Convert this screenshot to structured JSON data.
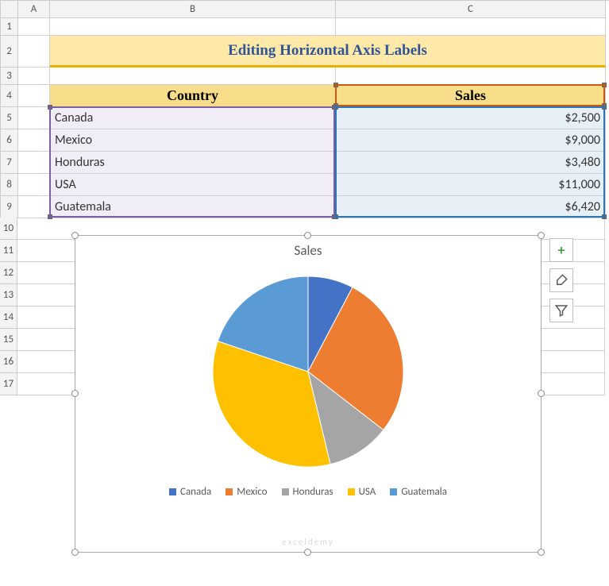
{
  "columns": {
    "A": "A",
    "B": "B",
    "C": "C"
  },
  "rows": [
    "1",
    "2",
    "3",
    "4",
    "5",
    "6",
    "7",
    "8",
    "9",
    "10",
    "11",
    "12",
    "13",
    "14",
    "15",
    "16",
    "17"
  ],
  "title": "Editing Horizontal Axis Labels",
  "table": {
    "headers": {
      "country": "Country",
      "sales": "Sales"
    },
    "rows": [
      {
        "country": "Canada",
        "sales": "$2,500"
      },
      {
        "country": "Mexico",
        "sales": "$9,000"
      },
      {
        "country": "Honduras",
        "sales": "$3,480"
      },
      {
        "country": "USA",
        "sales": "$11,000"
      },
      {
        "country": "Guatemala",
        "sales": "$6,420"
      }
    ]
  },
  "chart": {
    "title": "Sales",
    "legend": [
      "Canada",
      "Mexico",
      "Honduras",
      "USA",
      "Guatemala"
    ]
  },
  "chart_data": {
    "type": "pie",
    "title": "Sales",
    "categories": [
      "Canada",
      "Mexico",
      "Honduras",
      "USA",
      "Guatemala"
    ],
    "values": [
      2500,
      9000,
      3480,
      11000,
      6420
    ],
    "colors": {
      "Canada": "#4472c4",
      "Mexico": "#ed7d31",
      "Honduras": "#a5a5a5",
      "USA": "#ffc000",
      "Guatemala": "#5b9bd5"
    }
  },
  "side_buttons": {
    "plus": "chart-elements-button",
    "brush": "chart-styles-button",
    "filter": "chart-filters-button"
  },
  "watermark": "exceldemy"
}
